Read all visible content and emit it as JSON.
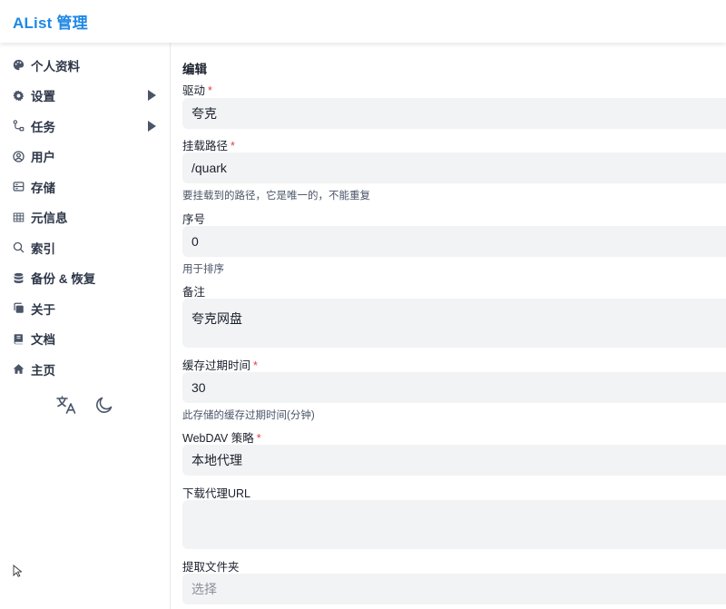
{
  "header": {
    "title": "AList 管理"
  },
  "sidebar": {
    "items": [
      {
        "label": "个人资料",
        "icon": "palette-icon",
        "has_children": false
      },
      {
        "label": "设置",
        "icon": "gear-icon",
        "has_children": true
      },
      {
        "label": "任务",
        "icon": "workflow-icon",
        "has_children": true
      },
      {
        "label": "用户",
        "icon": "user-circle-icon",
        "has_children": false
      },
      {
        "label": "存储",
        "icon": "storage-icon",
        "has_children": false
      },
      {
        "label": "元信息",
        "icon": "meta-grid-icon",
        "has_children": false
      },
      {
        "label": "索引",
        "icon": "search-icon",
        "has_children": false
      },
      {
        "label": "备份 & 恢复",
        "icon": "database-icon",
        "has_children": false
      },
      {
        "label": "关于",
        "icon": "copy-icon",
        "has_children": false
      },
      {
        "label": "文档",
        "icon": "book-icon",
        "has_children": false
      },
      {
        "label": "主页",
        "icon": "home-icon",
        "has_children": false
      }
    ],
    "tools": [
      "translate-icon",
      "moon-icon"
    ]
  },
  "form": {
    "heading": "编辑",
    "driver": {
      "label": "驱动",
      "required": "*",
      "value": "夸克"
    },
    "mount_path": {
      "label": "挂载路径",
      "required": "*",
      "value": "/quark",
      "help": "要挂载到的路径，它是唯一的，不能重复"
    },
    "order": {
      "label": "序号",
      "value": "0",
      "help": "用于排序"
    },
    "remark": {
      "label": "备注",
      "value": "夸克网盘"
    },
    "cache_expiration": {
      "label": "缓存过期时间",
      "required": "*",
      "value": "30",
      "help": "此存储的缓存过期时间(分钟)"
    },
    "webdav_policy": {
      "label": "WebDAV 策略",
      "required": "*",
      "value": "本地代理"
    },
    "download_proxy_url": {
      "label": "下载代理URL",
      "value": ""
    },
    "extract_folder": {
      "label": "提取文件夹",
      "placeholder": "选择"
    }
  },
  "colors": {
    "brand": "#1e88e5",
    "required": "#e53e3e",
    "field_bg": "#f2f3f5"
  }
}
